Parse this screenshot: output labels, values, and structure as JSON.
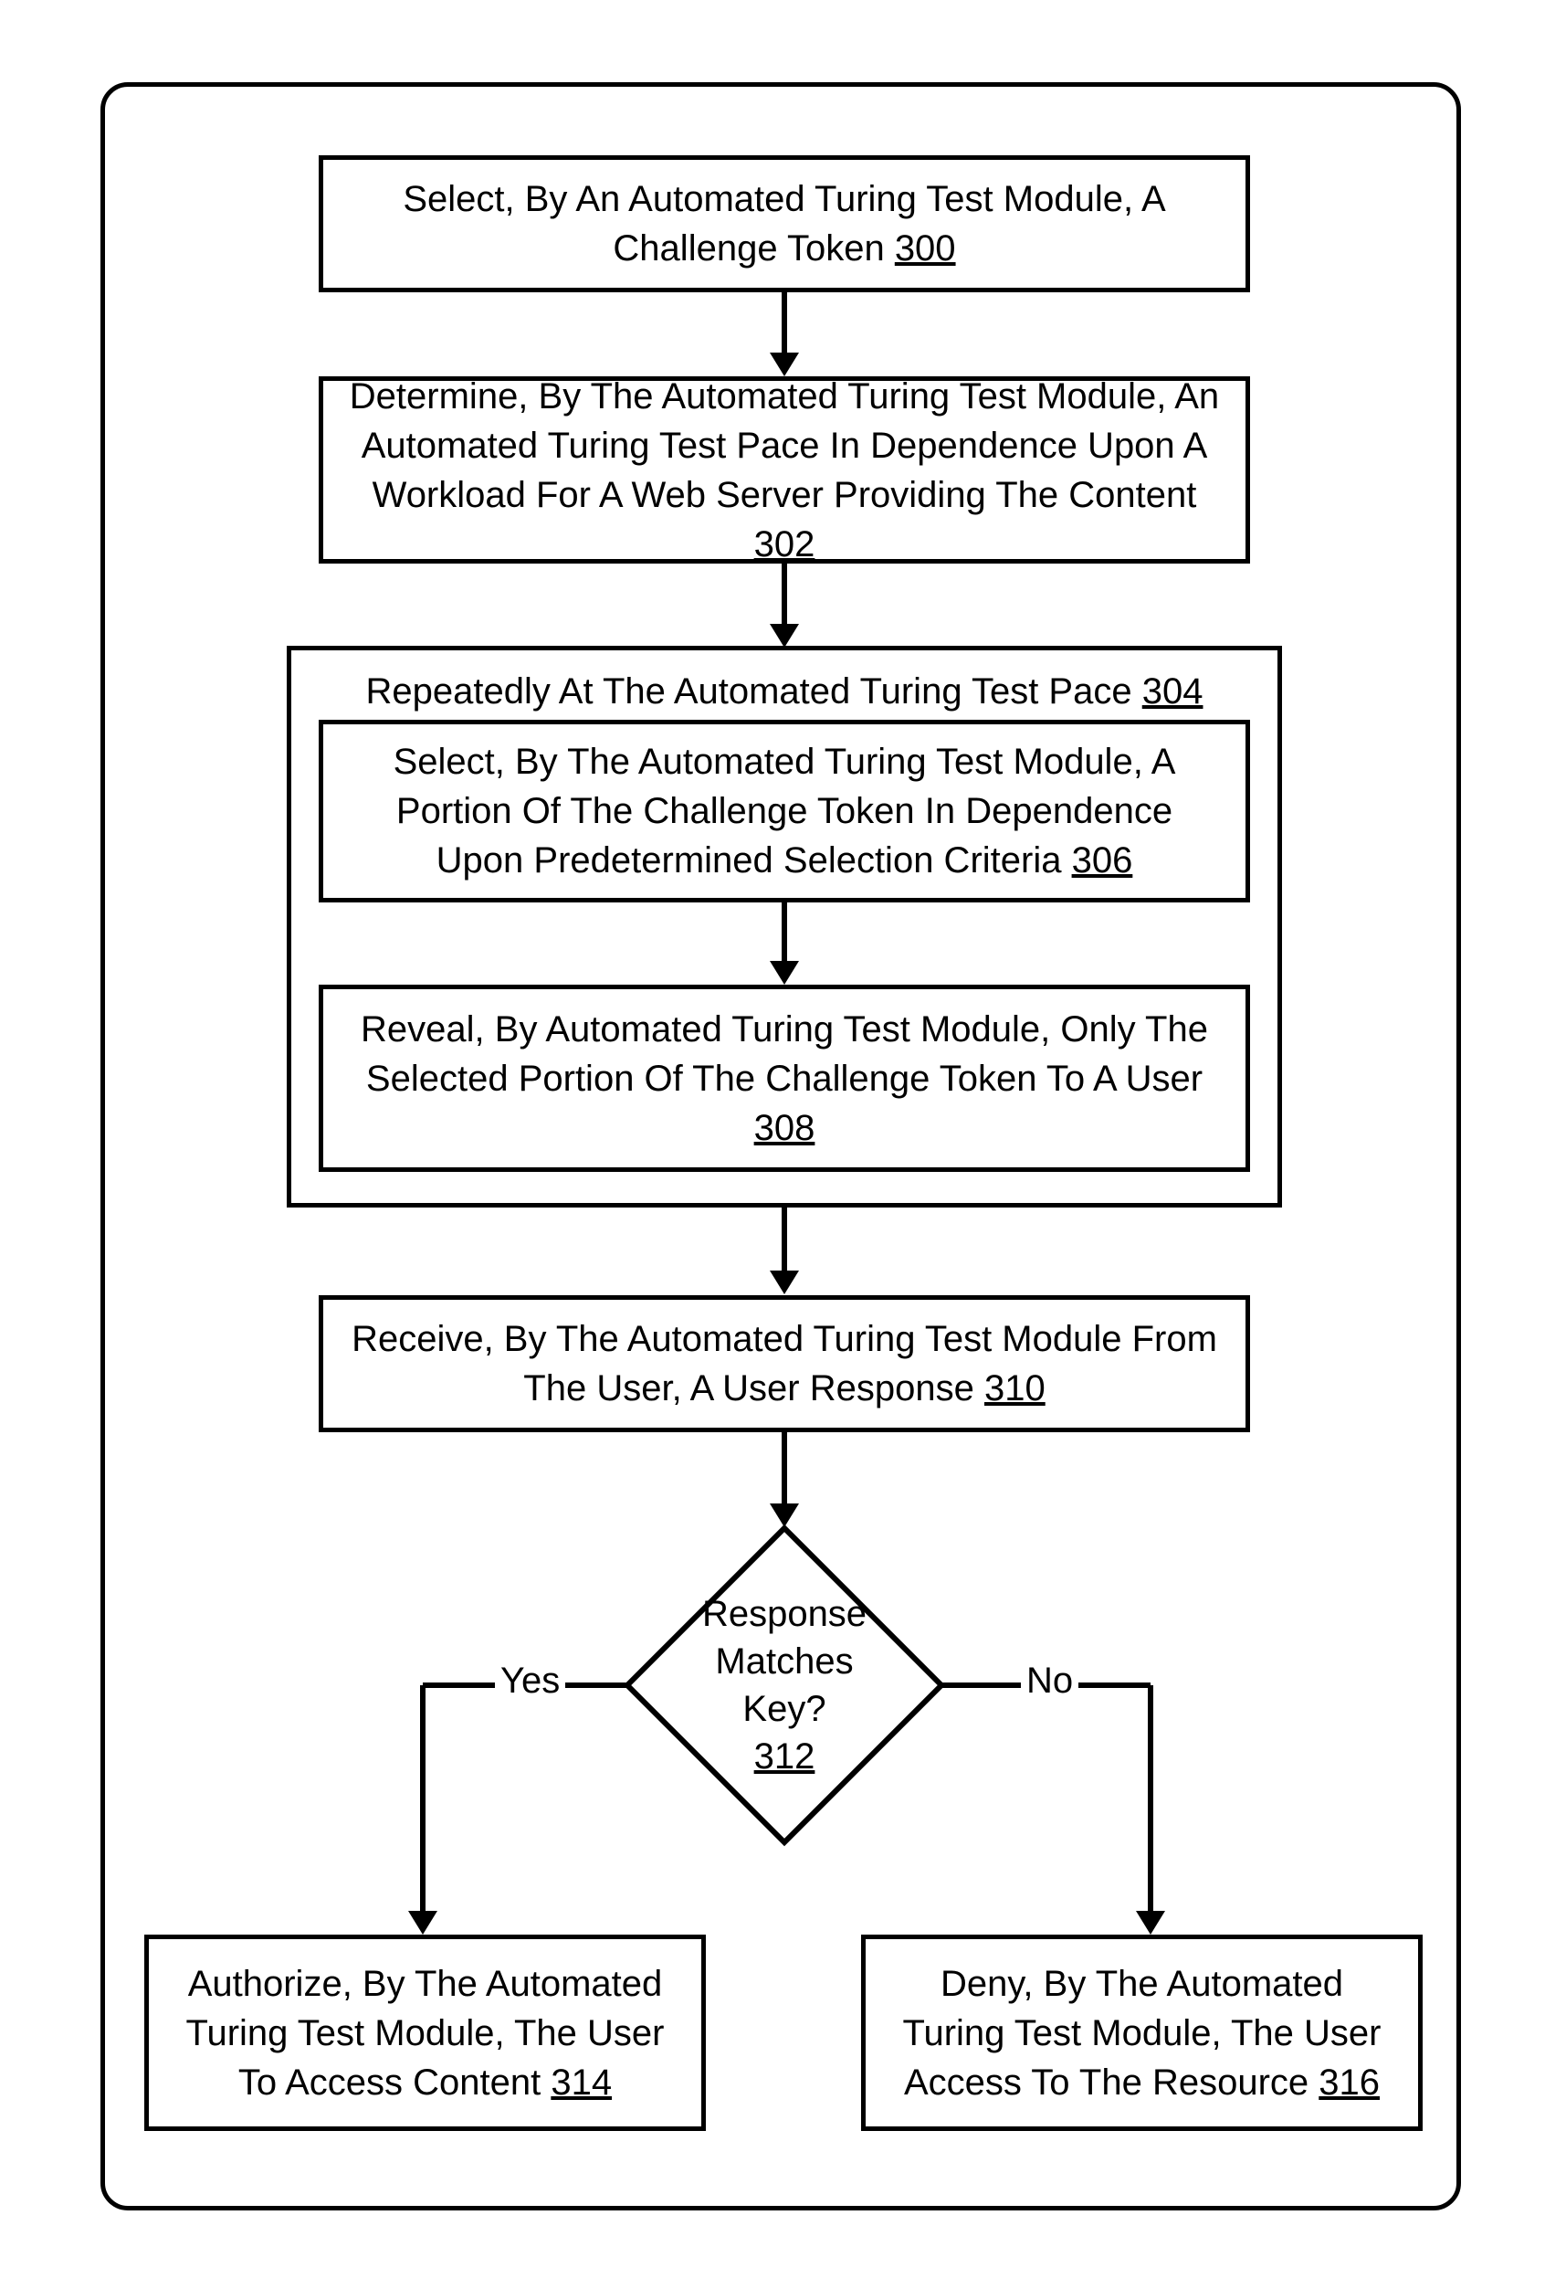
{
  "boxes": {
    "b300": {
      "text": "Select, By An Automated Turing Test Module, A Challenge Token ",
      "ref": "300"
    },
    "b302": {
      "text": "Determine, By The Automated Turing Test Module, An Automated Turing Test Pace In Dependence Upon A Workload For A Web Server Providing The Content ",
      "ref": "302"
    },
    "b304": {
      "title": "Repeatedly At The Automated Turing Test Pace ",
      "ref": "304"
    },
    "b306": {
      "text": "Select, By The Automated Turing Test Module, A Portion Of The Challenge Token In Dependence Upon Predetermined Selection Criteria ",
      "ref": "306"
    },
    "b308": {
      "text": "Reveal, By Automated Turing Test Module, Only The Selected Portion Of The Challenge Token To A User ",
      "ref": "308"
    },
    "b310": {
      "text": "Receive, By The Automated Turing Test Module From The User, A User Response ",
      "ref": "310"
    },
    "b312": {
      "line1": "Response",
      "line2": "Matches Key?",
      "ref": "312"
    },
    "b314": {
      "text": "Authorize, By The Automated Turing Test Module, The User To Access Content ",
      "ref": "314"
    },
    "b316": {
      "text": "Deny, By The Automated Turing Test Module, The User Access To The Resource ",
      "ref": "316"
    }
  },
  "labels": {
    "yes": "Yes",
    "no": "No"
  },
  "chart_data": {
    "type": "flowchart",
    "nodes": [
      {
        "id": "300",
        "type": "process",
        "label": "Select, By An Automated Turing Test Module, A Challenge Token"
      },
      {
        "id": "302",
        "type": "process",
        "label": "Determine, By The Automated Turing Test Module, An Automated Turing Test Pace In Dependence Upon A Workload For A Web Server Providing The Content"
      },
      {
        "id": "304",
        "type": "loop-container",
        "label": "Repeatedly At The Automated Turing Test Pace",
        "children": [
          "306",
          "308"
        ]
      },
      {
        "id": "306",
        "type": "process",
        "label": "Select, By The Automated Turing Test Module, A Portion Of The Challenge Token In Dependence Upon Predetermined Selection Criteria"
      },
      {
        "id": "308",
        "type": "process",
        "label": "Reveal, By Automated Turing Test Module, Only The Selected Portion Of The Challenge Token To A User"
      },
      {
        "id": "310",
        "type": "process",
        "label": "Receive, By The Automated Turing Test Module From The User, A User Response"
      },
      {
        "id": "312",
        "type": "decision",
        "label": "Response Matches Key?"
      },
      {
        "id": "314",
        "type": "process",
        "label": "Authorize, By The Automated Turing Test Module, The User To Access Content"
      },
      {
        "id": "316",
        "type": "process",
        "label": "Deny, By The Automated Turing Test Module, The User Access To The Resource"
      }
    ],
    "edges": [
      {
        "from": "300",
        "to": "302"
      },
      {
        "from": "302",
        "to": "304"
      },
      {
        "from": "306",
        "to": "308"
      },
      {
        "from": "304",
        "to": "310"
      },
      {
        "from": "310",
        "to": "312"
      },
      {
        "from": "312",
        "to": "314",
        "label": "Yes"
      },
      {
        "from": "312",
        "to": "316",
        "label": "No"
      }
    ]
  }
}
